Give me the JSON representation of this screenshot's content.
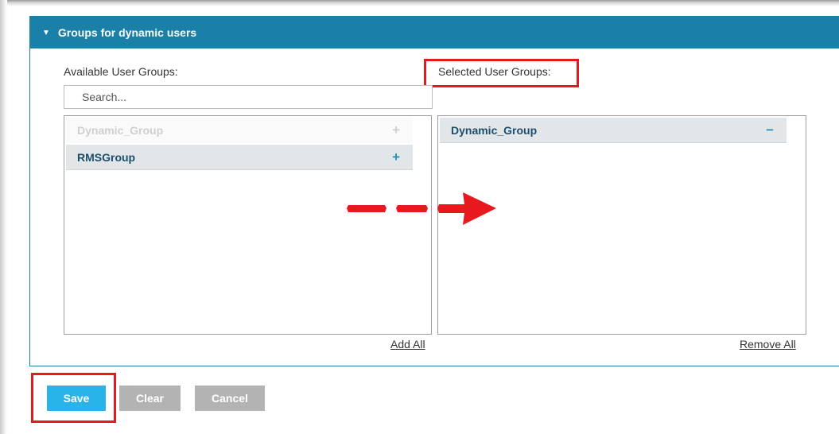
{
  "panel": {
    "title": "Groups for dynamic users"
  },
  "available": {
    "label": "Available User Groups:",
    "search_placeholder": "Search...",
    "items": [
      {
        "label": "Dynamic_Group",
        "action": "+",
        "state": "disabled"
      },
      {
        "label": "RMSGroup",
        "action": "+",
        "state": "available"
      }
    ],
    "add_all": "Add All"
  },
  "selected": {
    "label": "Selected User Groups:",
    "items": [
      {
        "label": "Dynamic_Group",
        "action": "−"
      }
    ],
    "remove_all": "Remove All"
  },
  "buttons": {
    "save": "Save",
    "clear": "Clear",
    "cancel": "Cancel"
  },
  "colors": {
    "header": "#1a80a8",
    "save": "#28b4e8",
    "disabled_button": "#b3b3b3",
    "annotation": "#e8191c"
  }
}
